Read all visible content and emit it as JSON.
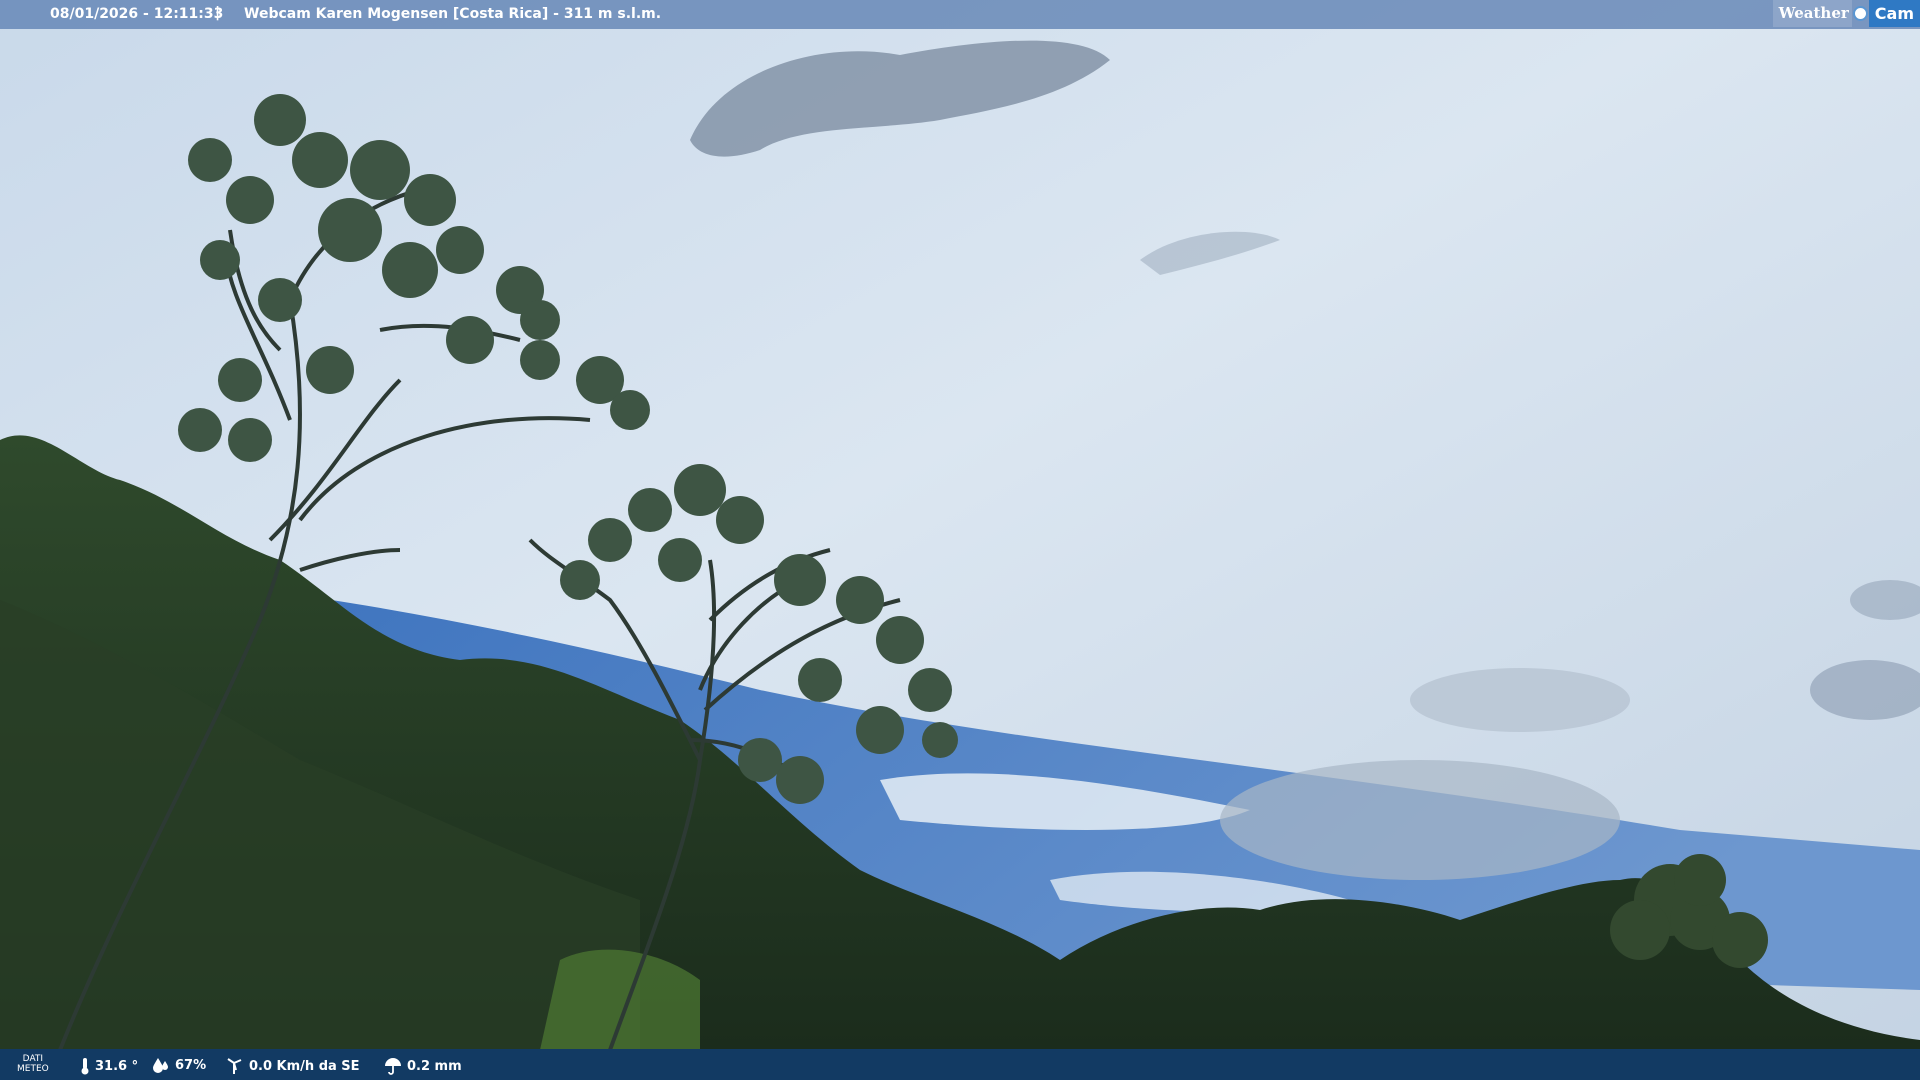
{
  "header": {
    "datetime": "08/01/2026 - 12:11:33",
    "separator": "|",
    "title": "Webcam Karen Mogensen [Costa Rica]  - 311 m s.l.m."
  },
  "logo": {
    "weather": "Weather",
    "cam": "Cam"
  },
  "weather": {
    "label_line1": "DATI",
    "label_line2": "METEO",
    "temperature": "31.6 °",
    "humidity": "67%",
    "wind": "0.0 Km/h da SE",
    "rain": "0.2 mm"
  },
  "icons": [
    "thermometer-icon",
    "humidity-drop-icon",
    "wind-icon",
    "rain-umbrella-icon"
  ]
}
